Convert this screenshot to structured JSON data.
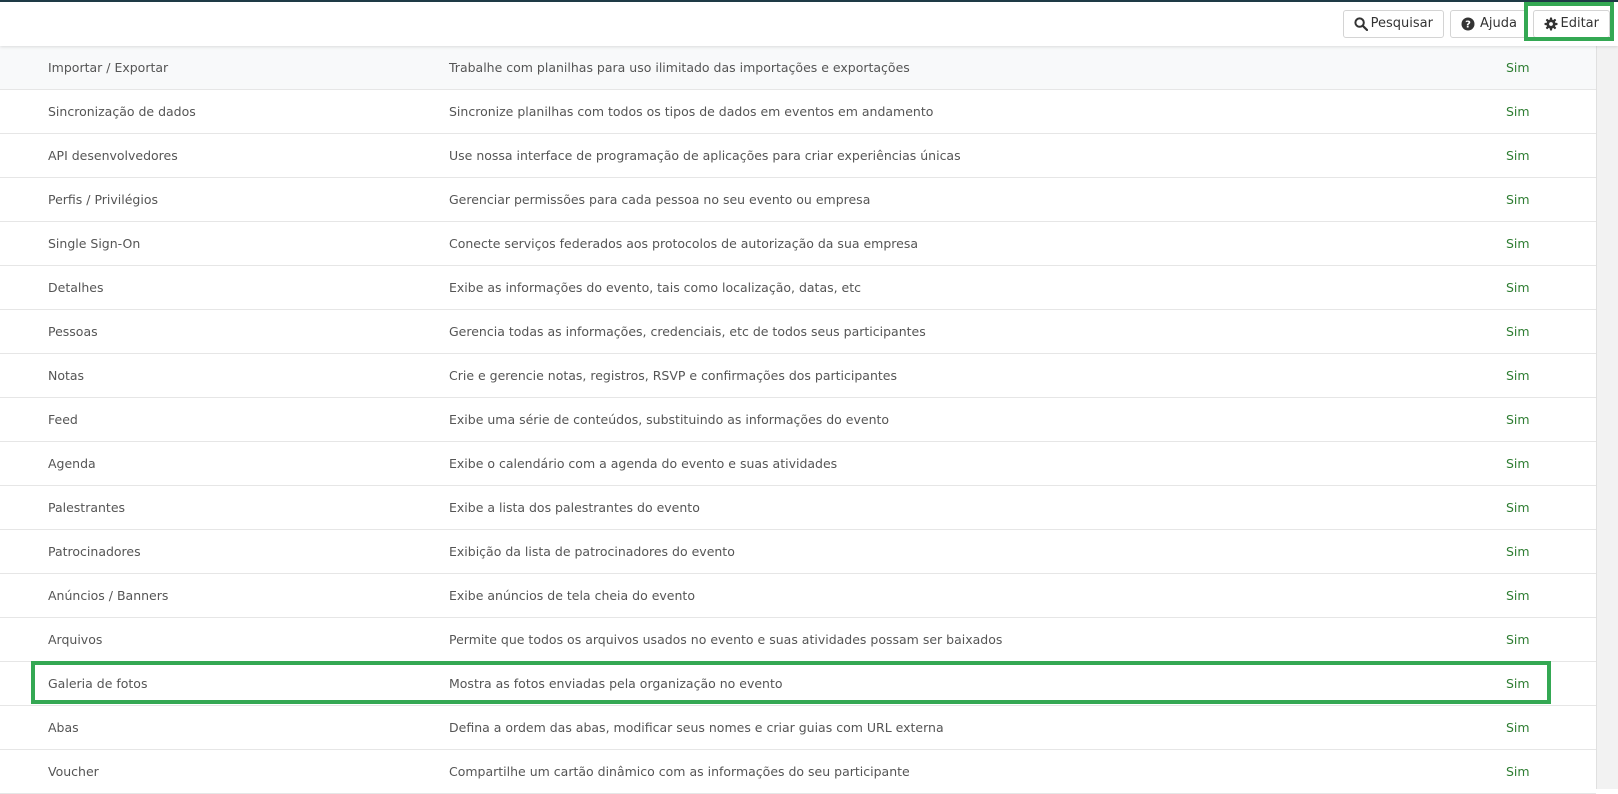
{
  "toolbar": {
    "search_label": "Pesquisar",
    "help_label": "Ajuda",
    "edit_label": "Editar",
    "search_icon": "search-icon",
    "help_icon": "question-circle-icon",
    "edit_icon": "gear-icon"
  },
  "colors": {
    "highlight": "#34a853",
    "value_green": "#2e7d32",
    "topline": "#1f3b47"
  },
  "rows": [
    {
      "name": "Importar / Exportar",
      "desc": "Trabalhe com planilhas para uso ilimitado das importações e exportações",
      "value": "Sim"
    },
    {
      "name": "Sincronização de dados",
      "desc": "Sincronize planilhas com todos os tipos de dados em eventos em andamento",
      "value": "Sim"
    },
    {
      "name": "API desenvolvedores",
      "desc": "Use nossa interface de programação de aplicações para criar experiências únicas",
      "value": "Sim"
    },
    {
      "name": "Perfis / Privilégios",
      "desc": "Gerenciar permissões para cada pessoa no seu evento ou empresa",
      "value": "Sim"
    },
    {
      "name": "Single Sign-On",
      "desc": "Conecte serviços federados aos protocolos de autorização da sua empresa",
      "value": "Sim"
    },
    {
      "name": "Detalhes",
      "desc": "Exibe as informações do evento, tais como localização, datas, etc",
      "value": "Sim"
    },
    {
      "name": "Pessoas",
      "desc": "Gerencia todas as informações, credenciais, etc de todos seus participantes",
      "value": "Sim"
    },
    {
      "name": "Notas",
      "desc": "Crie e gerencie notas, registros, RSVP e confirmações dos participantes",
      "value": "Sim"
    },
    {
      "name": "Feed",
      "desc": "Exibe uma série de conteúdos, substituindo as informações do evento",
      "value": "Sim"
    },
    {
      "name": "Agenda",
      "desc": "Exibe o calendário com a agenda do evento e suas atividades",
      "value": "Sim"
    },
    {
      "name": "Palestrantes",
      "desc": "Exibe a lista dos palestrantes do evento",
      "value": "Sim"
    },
    {
      "name": "Patrocinadores",
      "desc": "Exibição da lista de patrocinadores do evento",
      "value": "Sim"
    },
    {
      "name": "Anúncios / Banners",
      "desc": "Exibe anúncios de tela cheia do evento",
      "value": "Sim"
    },
    {
      "name": "Arquivos",
      "desc": "Permite que todos os arquivos usados no evento e suas atividades possam ser baixados",
      "value": "Sim"
    },
    {
      "name": "Galeria de fotos",
      "desc": "Mostra as fotos enviadas pela organização no evento",
      "value": "Sim"
    },
    {
      "name": "Abas",
      "desc": "Defina a ordem das abas, modificar seus nomes e criar guias com URL externa",
      "value": "Sim"
    },
    {
      "name": "Voucher",
      "desc": "Compartilhe um cartão dinâmico com as informações do seu participante",
      "value": "Sim"
    }
  ]
}
